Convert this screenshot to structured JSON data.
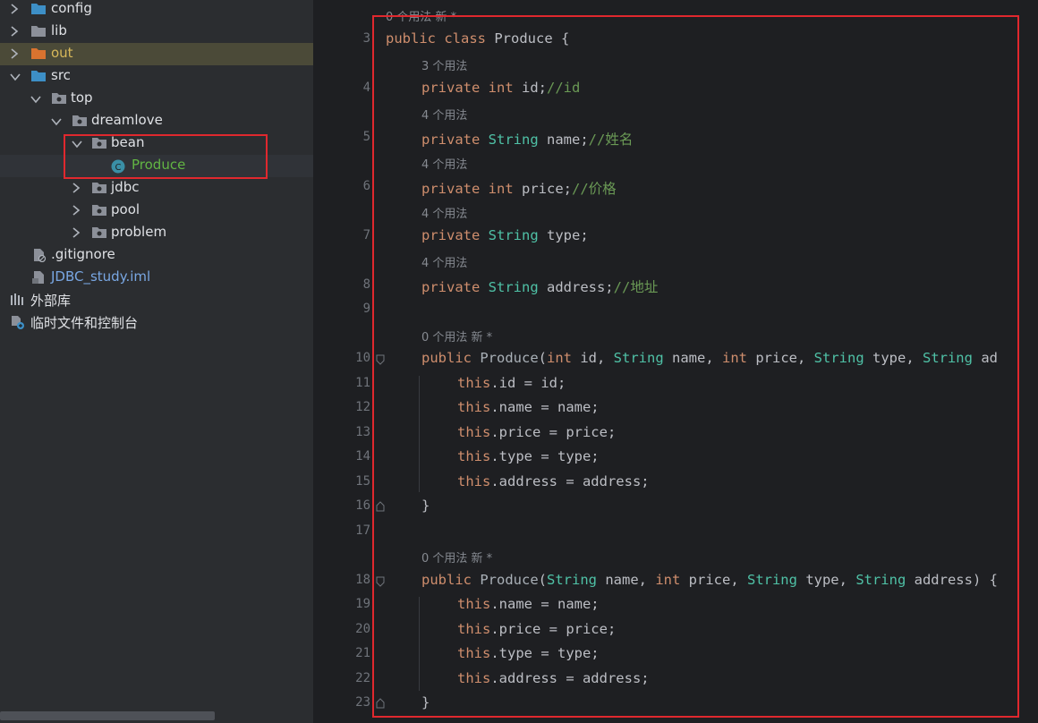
{
  "tree": {
    "items": [
      {
        "label": "config",
        "kind": "folder"
      },
      {
        "label": "lib",
        "kind": "folder"
      },
      {
        "label": "out",
        "kind": "folder-excluded"
      },
      {
        "label": "src",
        "kind": "folder-source"
      },
      {
        "label": "top",
        "kind": "package"
      },
      {
        "label": "dreamlove",
        "kind": "package"
      },
      {
        "label": "bean",
        "kind": "package"
      },
      {
        "label": "Produce",
        "kind": "class",
        "badge": "C"
      },
      {
        "label": "jdbc",
        "kind": "package"
      },
      {
        "label": "pool",
        "kind": "package"
      },
      {
        "label": "problem",
        "kind": "package"
      },
      {
        "label": ".gitignore",
        "kind": "file"
      },
      {
        "label": "JDBC_study.iml",
        "kind": "module-file"
      },
      {
        "label": "外部库",
        "kind": "libraries"
      },
      {
        "label": "临时文件和控制台",
        "kind": "scratches"
      }
    ]
  },
  "editor": {
    "hints": {
      "top": "0 个用法   新 *",
      "h3": "3 个用法",
      "h4a": "4 个用法",
      "h4b": "4 个用法",
      "h4c": "4 个用法",
      "h4d": "4 个用法",
      "hctor1": "0 个用法   新 *",
      "hctor2": "0 个用法   新 *"
    },
    "line_numbers": [
      "3",
      "4",
      "5",
      "6",
      "7",
      "8",
      "9",
      "10",
      "11",
      "12",
      "13",
      "14",
      "15",
      "16",
      "17",
      "18",
      "19",
      "20",
      "21",
      "22",
      "23"
    ],
    "lines": {
      "l3": {
        "a": "public class ",
        "b": "Produce",
        "c": " {"
      },
      "l4": {
        "a": "private ",
        "b": "int",
        "c": " id;",
        "d": "//id"
      },
      "l5": {
        "a": "private ",
        "b": "String",
        "c": " name;",
        "d": "//姓名"
      },
      "l6": {
        "a": "private ",
        "b": "int",
        "c": " price;",
        "d": "//价格"
      },
      "l7": {
        "a": "private ",
        "b": "String",
        "c": " type;"
      },
      "l8": {
        "a": "private ",
        "b": "String",
        "c": " address;",
        "d": "//地址"
      },
      "l10": {
        "a": "public ",
        "b": "Produce",
        "c": "(",
        "d": "int",
        "e": " id, ",
        "f": "String",
        "g": " name, ",
        "h": "int",
        "i": " price, ",
        "j": "String",
        "k": " type, ",
        "l": "String",
        "m": " ad"
      },
      "l11": {
        "a": "this",
        "b": ".id = id;"
      },
      "l12": {
        "a": "this",
        "b": ".name = name;"
      },
      "l13": {
        "a": "this",
        "b": ".price = price;"
      },
      "l14": {
        "a": "this",
        "b": ".type = type;"
      },
      "l15": {
        "a": "this",
        "b": ".address = address;"
      },
      "l16": {
        "a": "}"
      },
      "l18": {
        "a": "public ",
        "b": "Produce",
        "c": "(",
        "d": "String",
        "e": " name, ",
        "f": "int",
        "g": " price, ",
        "h": "String",
        "i": " type, ",
        "j": "String",
        "k": " address) {"
      },
      "l19": {
        "a": "this",
        "b": ".name = name;"
      },
      "l20": {
        "a": "this",
        "b": ".price = price;"
      },
      "l21": {
        "a": "this",
        "b": ".type = type;"
      },
      "l22": {
        "a": "this",
        "b": ".address = address;"
      },
      "l23": {
        "a": "}"
      }
    }
  },
  "colors": {
    "annotation_box": "#e0282e",
    "keyword": "#cf8e6d",
    "type": "#4fc1a6",
    "comment": "#6a9955"
  }
}
